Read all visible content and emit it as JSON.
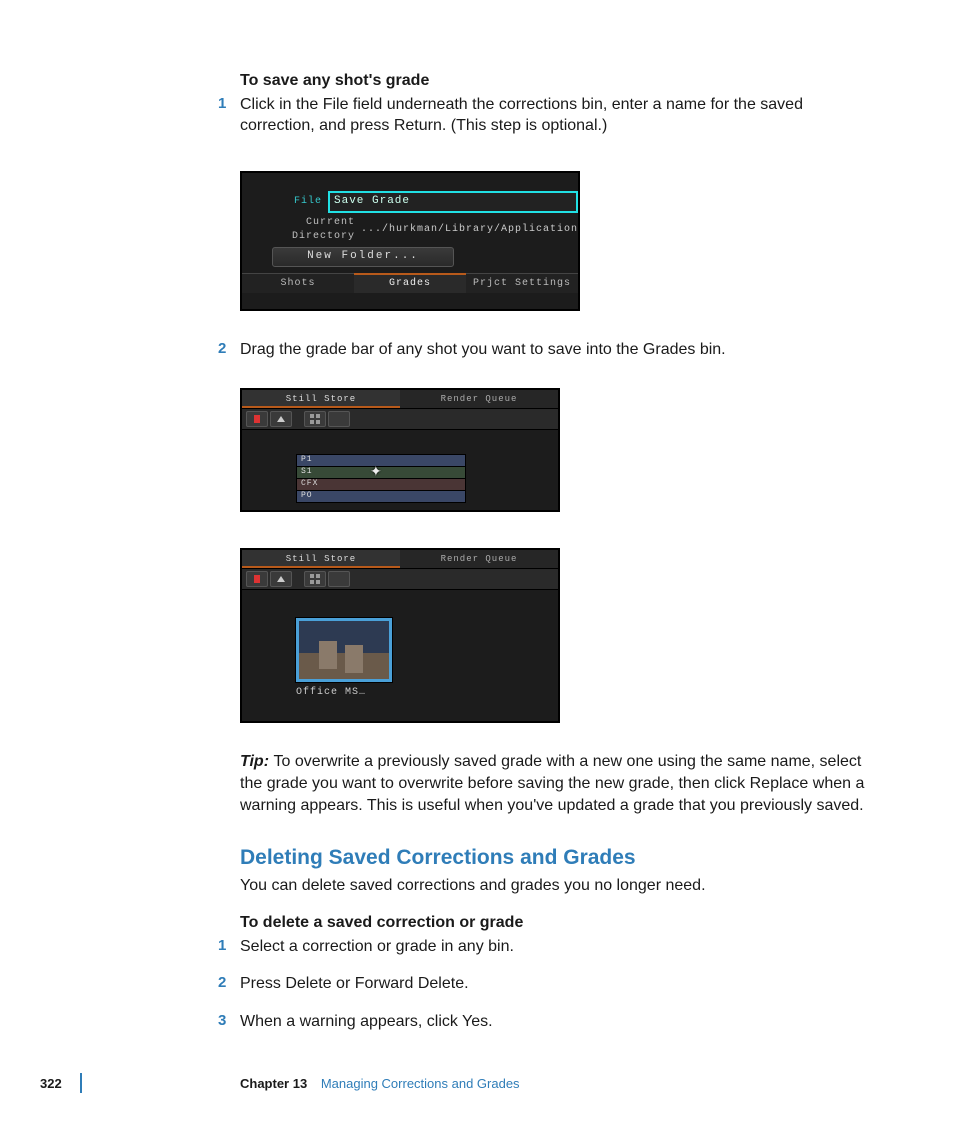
{
  "task1": {
    "heading": "To save any shot's grade",
    "step1_num": "1",
    "step1_text": "Click in the File field underneath the corrections bin, enter a name for the saved correction, and press Return. (This step is optional.)",
    "step2_num": "2",
    "step2_text": "Drag the grade bar of any shot you want to save into the Grades bin."
  },
  "shot1": {
    "file_label": "File",
    "file_value": "Save Grade",
    "cd_label": "Current Directory",
    "cd_value": ".../hurkman/Library/Application",
    "newfolder": "New Folder...",
    "tab_shots": "Shots",
    "tab_grades": "Grades",
    "tab_settings": "Prjct Settings"
  },
  "shot2": {
    "tab_still": "Still Store",
    "tab_render": "Render Queue",
    "bar_p1": "P1",
    "bar_s1": "S1",
    "bar_cfx": "CFX",
    "bar_po": "PO"
  },
  "shot3": {
    "tab_still": "Still Store",
    "tab_render": "Render Queue",
    "thumb_label": "Office MS…"
  },
  "tip": {
    "label": "Tip:  ",
    "body": "To overwrite a previously saved grade with a new one using the same name, select the grade you want to overwrite before saving the new grade, then click Replace when a warning appears. This is useful when you've updated a grade that you previously saved."
  },
  "section2": {
    "heading": "Deleting Saved Corrections and Grades",
    "intro": "You can delete saved corrections and grades you no longer need.",
    "task_heading": "To delete a saved correction or grade",
    "step1_num": "1",
    "step1_text": "Select a correction or grade in any bin.",
    "step2_num": "2",
    "step2_text": "Press Delete or Forward Delete.",
    "step3_num": "3",
    "step3_text": "When a warning appears, click Yes."
  },
  "footer": {
    "page": "322",
    "chapter_label": "Chapter 13",
    "chapter_title": "Managing Corrections and Grades"
  }
}
